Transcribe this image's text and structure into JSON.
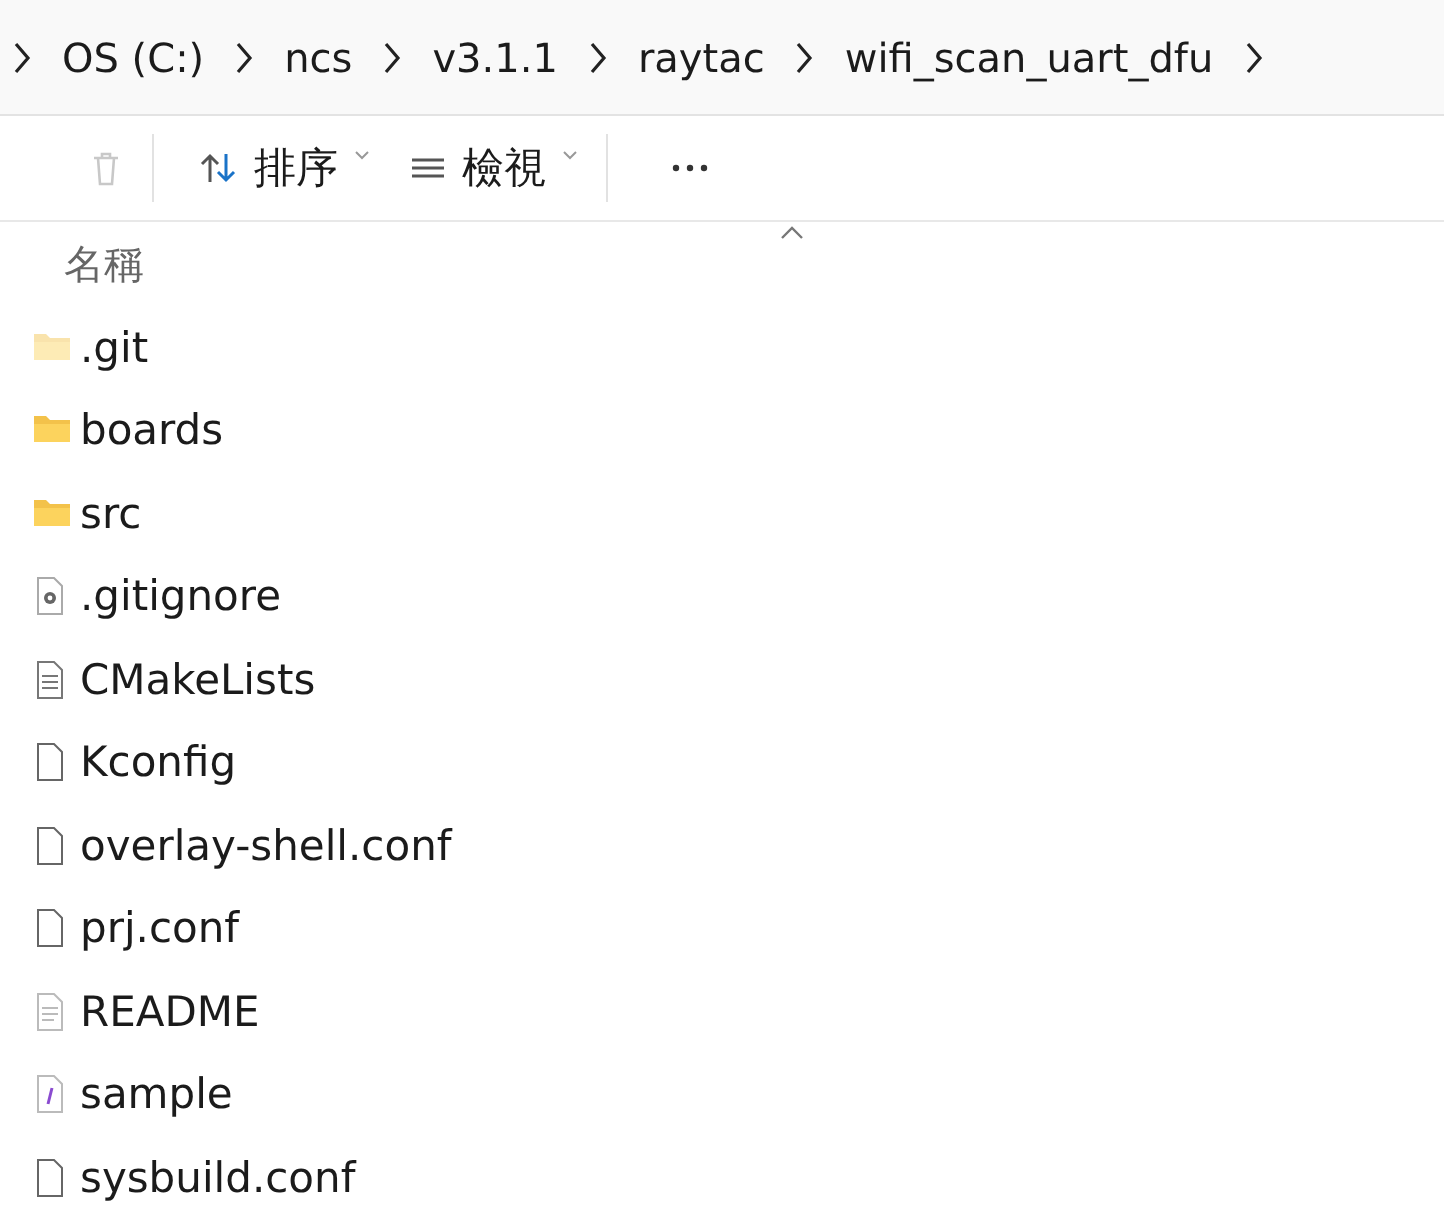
{
  "breadcrumb": [
    "OS (C:)",
    "ncs",
    "v3.1.1",
    "raytac",
    "wifi_scan_uart_dfu"
  ],
  "toolbar": {
    "delete": {
      "disabled": true
    },
    "sort": {
      "label": "排序"
    },
    "view": {
      "label": "檢視"
    }
  },
  "columns": [
    {
      "label": "名稱",
      "sorted": true
    }
  ],
  "files": [
    {
      "name": ".git",
      "kind": "folder",
      "hidden": true
    },
    {
      "name": "boards",
      "kind": "folder",
      "hidden": false
    },
    {
      "name": "src",
      "kind": "folder",
      "hidden": false
    },
    {
      "name": ".gitignore",
      "kind": "settings",
      "hidden": false
    },
    {
      "name": "CMakeLists",
      "kind": "text",
      "hidden": false
    },
    {
      "name": "Kconfig",
      "kind": "blank",
      "hidden": false
    },
    {
      "name": "overlay-shell.conf",
      "kind": "blank",
      "hidden": false
    },
    {
      "name": "prj.conf",
      "kind": "blank",
      "hidden": false
    },
    {
      "name": "README",
      "kind": "readme",
      "hidden": false
    },
    {
      "name": "sample",
      "kind": "sample",
      "hidden": false
    },
    {
      "name": "sysbuild.conf",
      "kind": "blank",
      "hidden": false
    }
  ]
}
